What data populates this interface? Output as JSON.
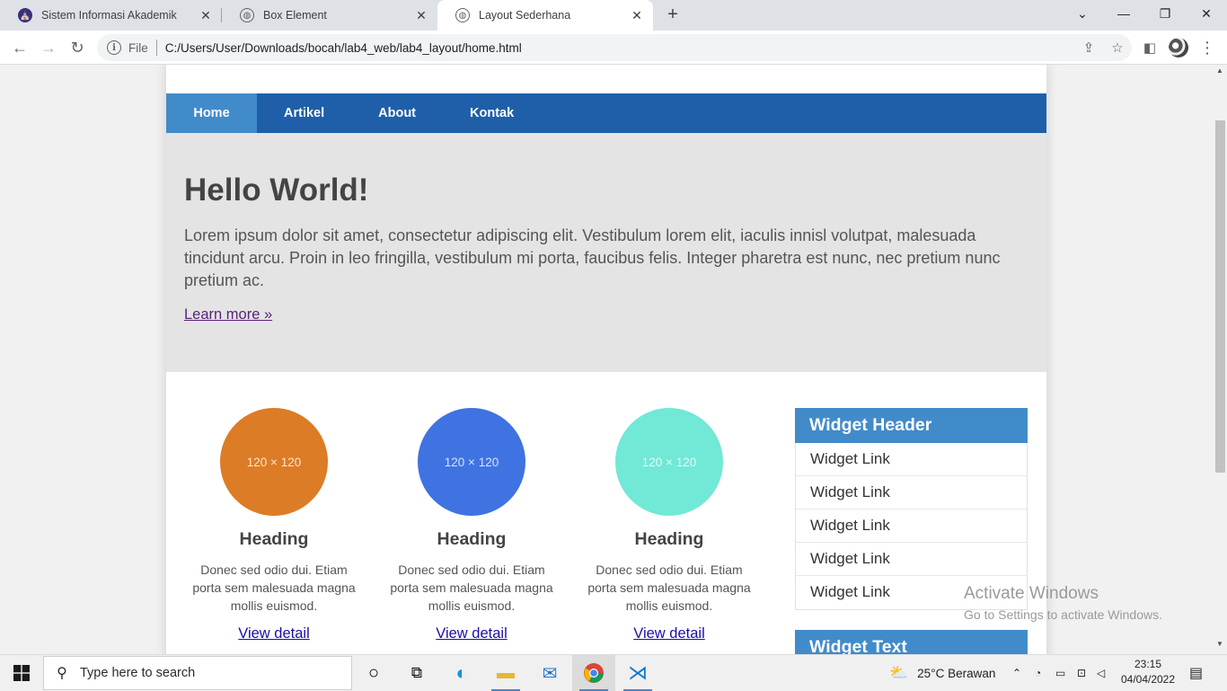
{
  "browser": {
    "tabs": [
      {
        "title": "Sistem Informasi Akademik",
        "active": false
      },
      {
        "title": "Box Element",
        "active": false
      },
      {
        "title": "Layout Sederhana",
        "active": true
      }
    ],
    "file_label": "File",
    "url": "C:/Users/User/Downloads/bocah/lab4_web/lab4_layout/home.html"
  },
  "page": {
    "nav": [
      "Home",
      "Artikel",
      "About",
      "Kontak"
    ],
    "hero": {
      "title": "Hello World!",
      "text": "Lorem ipsum dolor sit amet, consectetur adipiscing elit. Vestibulum lorem elit, iaculis innisl volutpat, malesuada tincidunt arcu. Proin in leo fringilla, vestibulum mi porta, faucibus felis. Integer pharetra est nunc, nec pretium nunc pretium ac.",
      "link": "Learn more »"
    },
    "boxes": [
      {
        "placeholder": "120 × 120",
        "color": "#dd7c26",
        "heading": "Heading",
        "text": "Donec sed odio dui. Etiam porta sem malesuada magna mollis euismod.",
        "link": "View detail"
      },
      {
        "placeholder": "120 × 120",
        "color": "#3f73e2",
        "heading": "Heading",
        "text": "Donec sed odio dui. Etiam porta sem malesuada magna mollis euismod.",
        "link": "View detail"
      },
      {
        "placeholder": "120 × 120",
        "color": "#72e8d6",
        "heading": "Heading",
        "text": "Donec sed odio dui. Etiam porta sem malesuada magna mollis euismod.",
        "link": "View detail"
      }
    ],
    "widget": {
      "header": "Widget Header",
      "links": [
        "Widget Link",
        "Widget Link",
        "Widget Link",
        "Widget Link",
        "Widget Link"
      ],
      "text_header": "Widget Text"
    }
  },
  "watermark": {
    "title": "Activate Windows",
    "subtitle": "Go to Settings to activate Windows."
  },
  "taskbar": {
    "search_placeholder": "Type here to search",
    "weather": "25°C  Berawan",
    "time": "23:15",
    "date": "04/04/2022"
  },
  "colors": {
    "nav_bg": "#1f5faa",
    "nav_active": "#428bca",
    "widget_header": "#428bca",
    "hero_bg": "#e4e4e4"
  }
}
